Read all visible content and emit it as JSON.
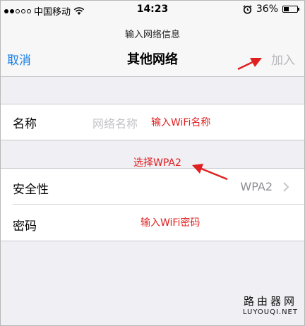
{
  "status_bar": {
    "carrier": "中国移动",
    "time": "14:23",
    "battery": "36%"
  },
  "nav": {
    "prompt": "输入网络信息",
    "cancel": "取消",
    "title": "其他网络",
    "join": "加入"
  },
  "name_row": {
    "label": "名称",
    "placeholder": "网络名称",
    "annotation": "输入WiFi名称"
  },
  "annotation_security": "选择WPA2",
  "security_row": {
    "label": "安全性",
    "value": "WPA2"
  },
  "password_row": {
    "label": "密码",
    "annotation": "输入WiFi密码"
  },
  "watermark": {
    "cn": "路由器网",
    "en": "LUYOUQI.NET"
  },
  "colors": {
    "accent": "#1a7fe6",
    "annotation": "#e02020"
  }
}
